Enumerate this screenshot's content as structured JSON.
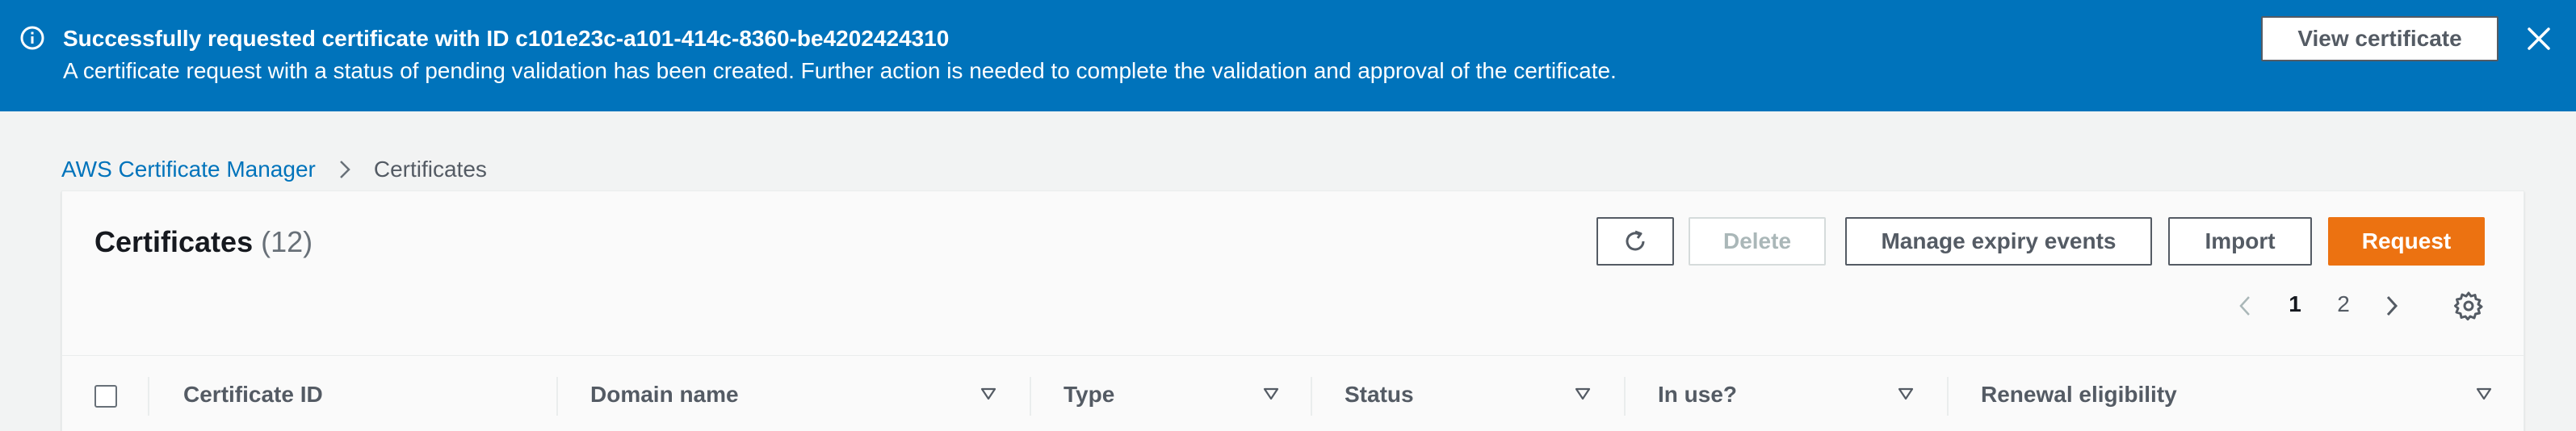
{
  "flash": {
    "title": "Successfully requested certificate with ID c101e23c-a101-414c-8360-be4202424310",
    "body": "A certificate request with a status of pending validation has been created. Further action is needed to complete the validation and approval of the certificate.",
    "view_button": "View certificate",
    "background": "#0073bb",
    "icons": {
      "info": "info-circle-icon",
      "close": "close-icon"
    }
  },
  "breadcrumb": {
    "root": "AWS Certificate Manager",
    "current": "Certificates"
  },
  "panel": {
    "title": "Certificates",
    "count": "(12)"
  },
  "actions": {
    "refresh_icon": "refresh-icon",
    "delete": "Delete",
    "manage_expiry": "Manage expiry events",
    "import": "Import",
    "request": "Request",
    "request_color": "#ec7211"
  },
  "pagination": {
    "pages": [
      "1",
      "2"
    ],
    "current_page": "1"
  },
  "columns": [
    {
      "label": "Certificate ID",
      "sortable": false
    },
    {
      "label": "Domain name",
      "sortable": true
    },
    {
      "label": "Type",
      "sortable": true
    },
    {
      "label": "Status",
      "sortable": true
    },
    {
      "label": "In use?",
      "sortable": true
    },
    {
      "label": "Renewal eligibility",
      "sortable": true
    }
  ]
}
